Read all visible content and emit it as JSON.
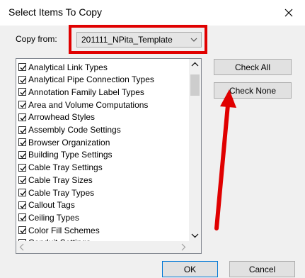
{
  "window": {
    "title": "Select Items To Copy"
  },
  "copy_from": {
    "label": "Copy from:",
    "selected": "201111_NPita_Template"
  },
  "list": {
    "items": [
      {
        "label": "Analytical Link Types",
        "checked": true
      },
      {
        "label": "Analytical Pipe Connection Types",
        "checked": true
      },
      {
        "label": "Annotation Family Label Types",
        "checked": true
      },
      {
        "label": "Area and Volume Computations",
        "checked": true
      },
      {
        "label": "Arrowhead Styles",
        "checked": true
      },
      {
        "label": "Assembly Code Settings",
        "checked": true
      },
      {
        "label": "Browser Organization",
        "checked": true
      },
      {
        "label": "Building Type Settings",
        "checked": true
      },
      {
        "label": "Cable Tray Settings",
        "checked": true
      },
      {
        "label": "Cable Tray Sizes",
        "checked": true
      },
      {
        "label": "Cable Tray Types",
        "checked": true
      },
      {
        "label": "Callout Tags",
        "checked": true
      },
      {
        "label": "Ceiling Types",
        "checked": true
      },
      {
        "label": "Color Fill Schemes",
        "checked": true
      },
      {
        "label": "Conduit Settings",
        "checked": true
      }
    ]
  },
  "buttons": {
    "check_all": "Check All",
    "check_none": "Check None",
    "ok": "OK",
    "cancel": "Cancel"
  },
  "colors": {
    "highlight": "#e00000",
    "accent": "#0078d7"
  }
}
